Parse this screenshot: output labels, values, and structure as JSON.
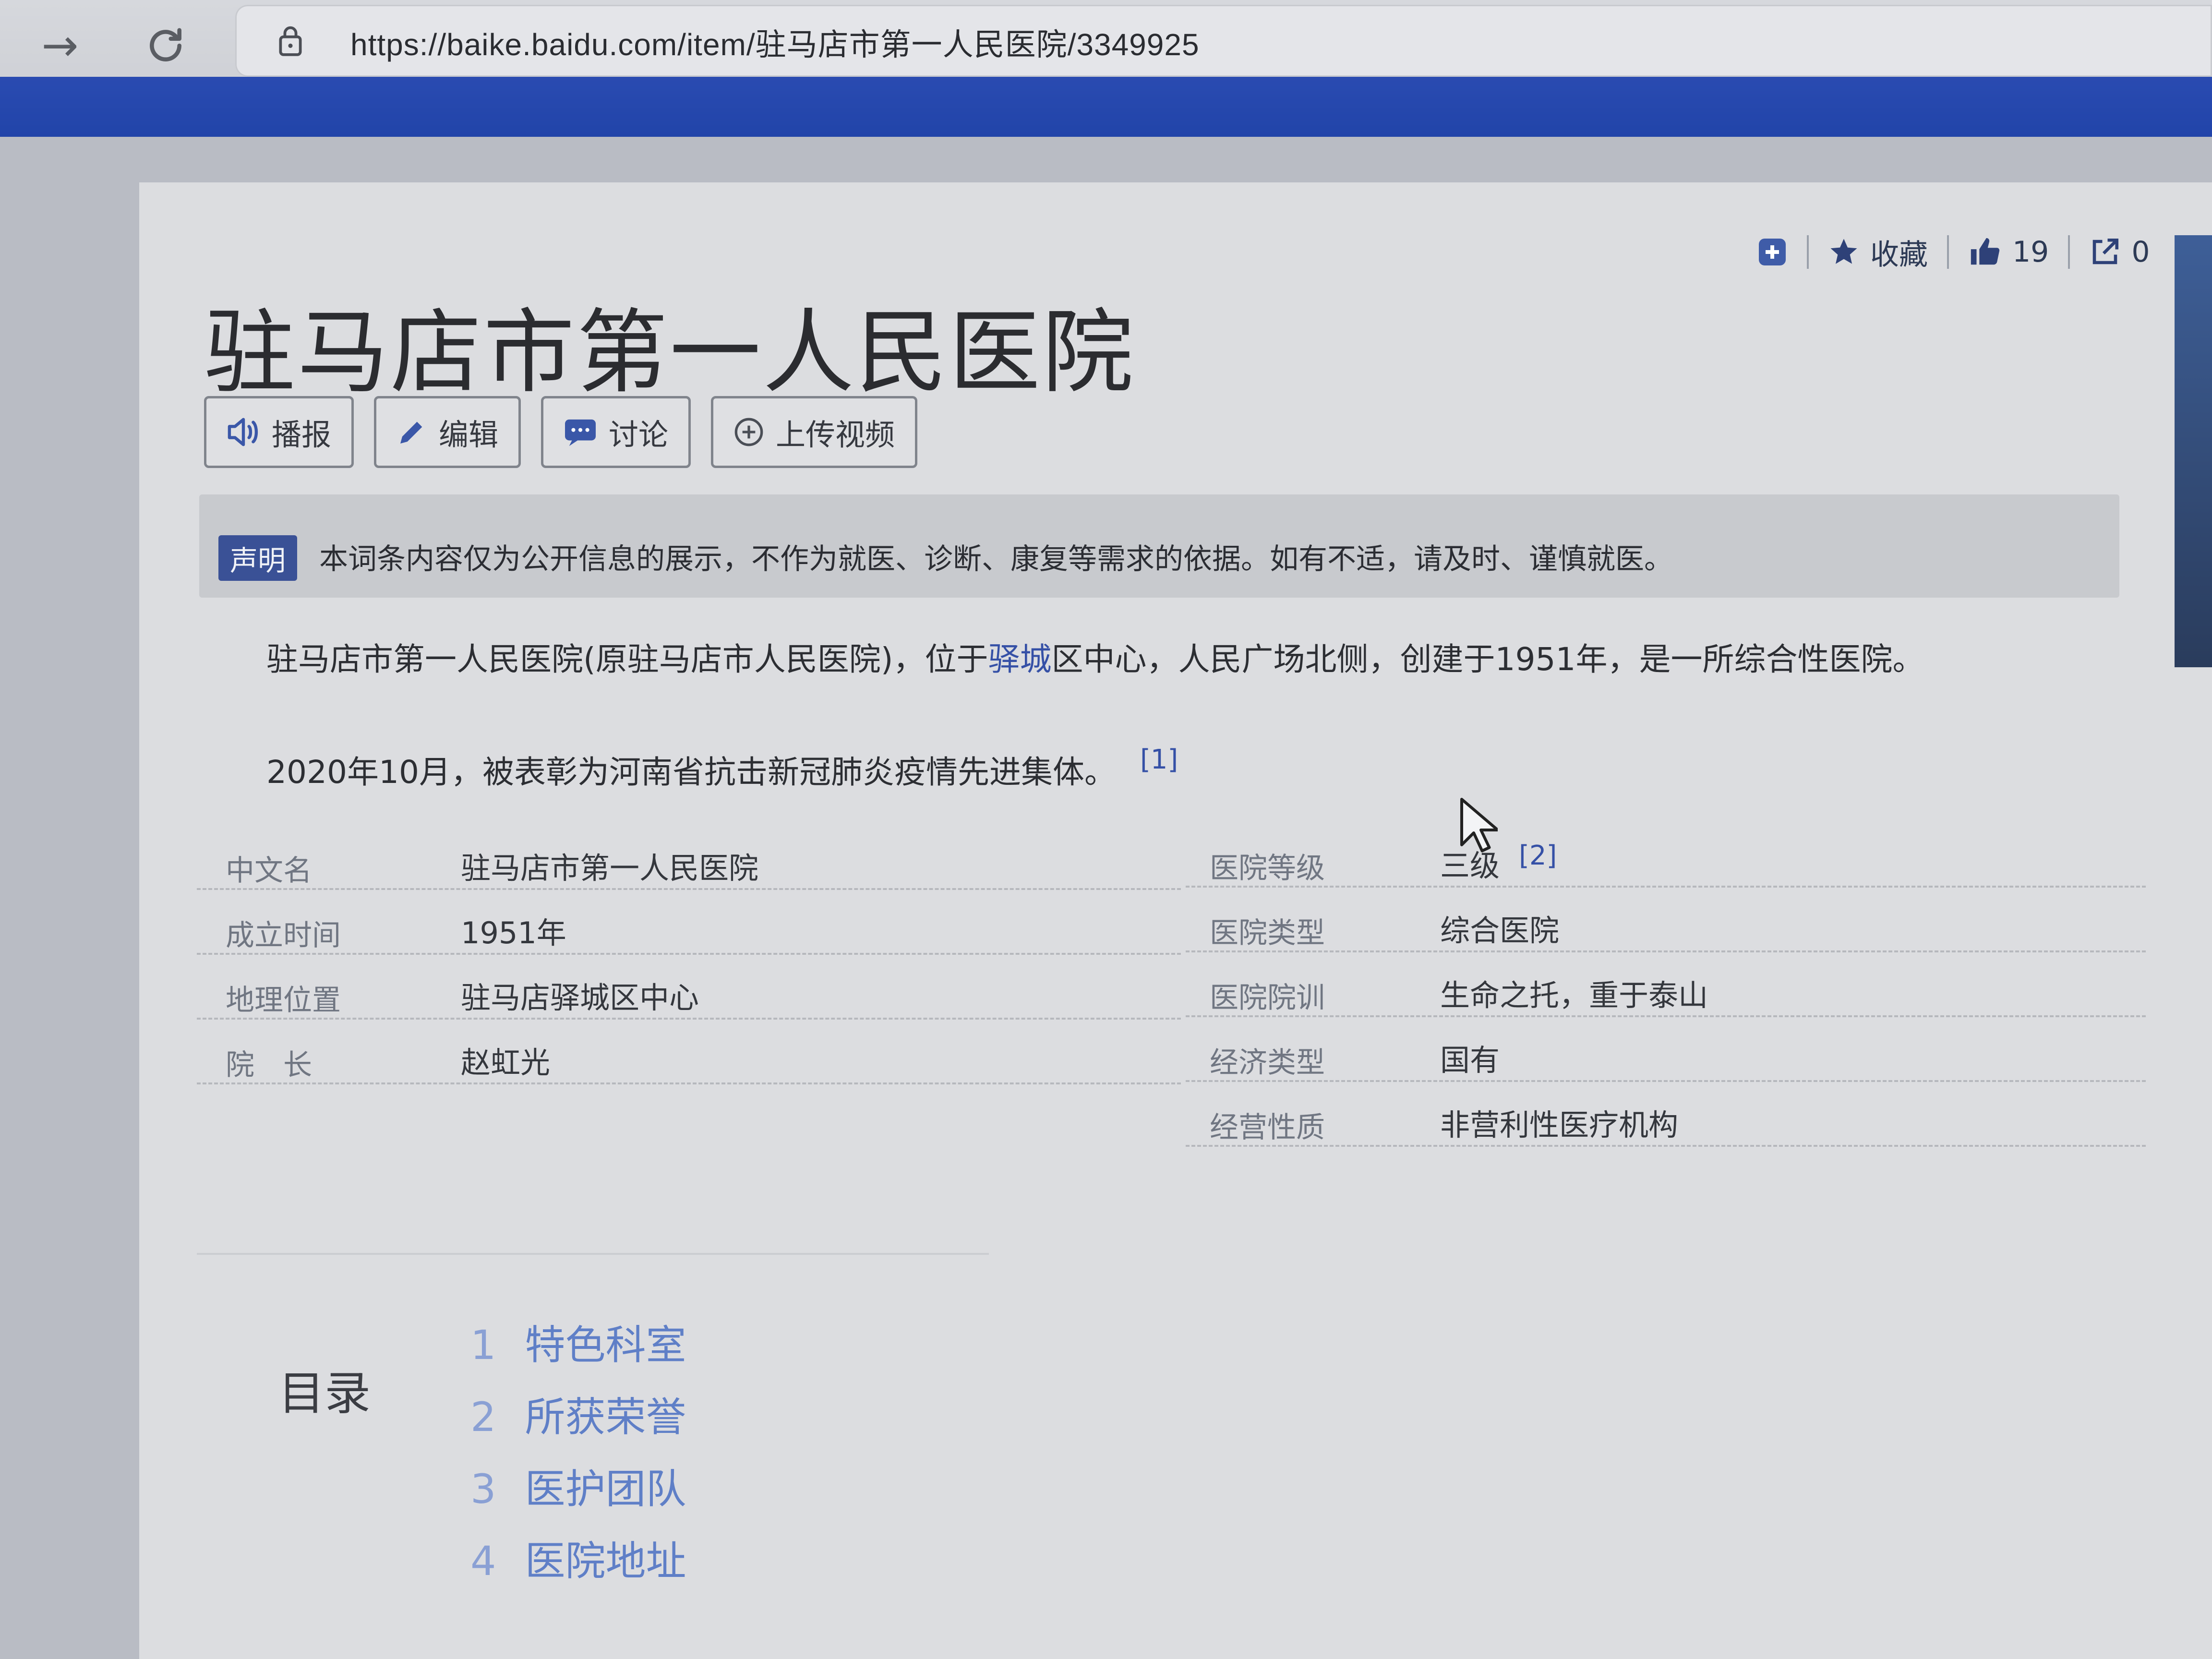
{
  "browser": {
    "back_icon": "arrow-right-icon",
    "reload_icon": "reload-icon",
    "lock_icon": "lock-icon",
    "url": "https://baike.baidu.com/item/驻马店市第一人民医院/3349925"
  },
  "toolbar": {
    "favorite_label": "收藏",
    "like_count": "19",
    "share_count": "0"
  },
  "article": {
    "title": "驻马店市第一人民医院",
    "actions": {
      "broadcast": "播报",
      "edit": "编辑",
      "discuss": "讨论",
      "upload_video": "上传视频"
    },
    "notice": {
      "tag": "声明",
      "text": "本词条内容仅为公开信息的展示，不作为就医、诊断、康复等需求的依据。如有不适，请及时、谨慎就医。"
    },
    "summary": {
      "p1_before": "驻马店市第一人民医院(原驻马店市人民医院)，位于",
      "p1_link": "驿城",
      "p1_after": "区中心，人民广场北侧，创建于1951年，是一所综合性医院。",
      "p2": "2020年10月，被表彰为河南省抗击新冠肺炎疫情先进集体。",
      "p2_ref": "[1]"
    },
    "info_left": [
      {
        "key": "中文名",
        "value": "驻马店市第一人民医院"
      },
      {
        "key": "成立时间",
        "value": "1951年"
      },
      {
        "key": "地理位置",
        "value": "驻马店驿城区中心"
      },
      {
        "key": "院　长",
        "value": "赵虹光"
      }
    ],
    "info_right": [
      {
        "key": "医院等级",
        "value": "三级",
        "ref": "[2]"
      },
      {
        "key": "医院类型",
        "value": "综合医院"
      },
      {
        "key": "医院院训",
        "value": "生命之托，重于泰山"
      },
      {
        "key": "经济类型",
        "value": "国有"
      },
      {
        "key": "经营性质",
        "value": "非营利性医疗机构"
      }
    ],
    "toc": {
      "title": "目录",
      "items": [
        {
          "num": "1",
          "label": "特色科室"
        },
        {
          "num": "2",
          "label": "所获荣誉"
        },
        {
          "num": "3",
          "label": "医护团队"
        },
        {
          "num": "4",
          "label": "医院地址"
        }
      ]
    }
  }
}
